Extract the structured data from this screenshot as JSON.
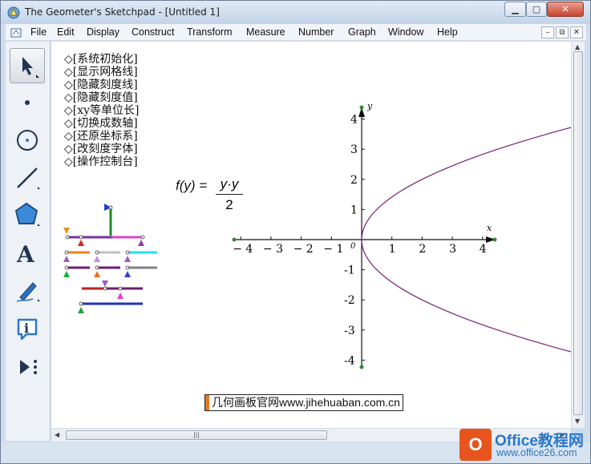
{
  "window": {
    "title": "The Geometer's Sketchpad - [Untitled 1]"
  },
  "menu": [
    "File",
    "Edit",
    "Display",
    "Construct",
    "Transform",
    "Measure",
    "Number",
    "Graph",
    "Window",
    "Help"
  ],
  "tools": [
    "arrow-tool",
    "point-tool",
    "compass-tool",
    "straightedge-tool",
    "polygon-tool",
    "text-tool",
    "marker-tool",
    "information-tool",
    "custom-tool"
  ],
  "commands": [
    "◇[系统初始化]",
    "◇[显示网格线]",
    "◇[隐藏刻度线]",
    "◇[隐藏刻度值]",
    "◇[xy等单位长]",
    "◇[切换成数轴]",
    "◇[还原坐标系]",
    "◇[改刻度字体]",
    "◇[操作控制台]"
  ],
  "function": {
    "lhs": "f(y) =",
    "numerator": "y·y",
    "denominator": "2"
  },
  "axes": {
    "x_label": "x",
    "y_label": "y",
    "origin": "0",
    "x_ticks": [
      "-4",
      "-3",
      "-2",
      "-1",
      "1",
      "2",
      "3",
      "4"
    ],
    "y_ticks": [
      "4",
      "3",
      "2",
      "1",
      "-1",
      "-2",
      "-3",
      "-4"
    ]
  },
  "curve": {
    "equation": "x = y^2 / 2",
    "y_range": [
      -4,
      4
    ],
    "color": "#7a1f78"
  },
  "watermarks": {
    "site": "几何画板官网www.jihehuaban.com.cn",
    "brand": "Office教程网",
    "brand_url": "www.office26.com"
  }
}
